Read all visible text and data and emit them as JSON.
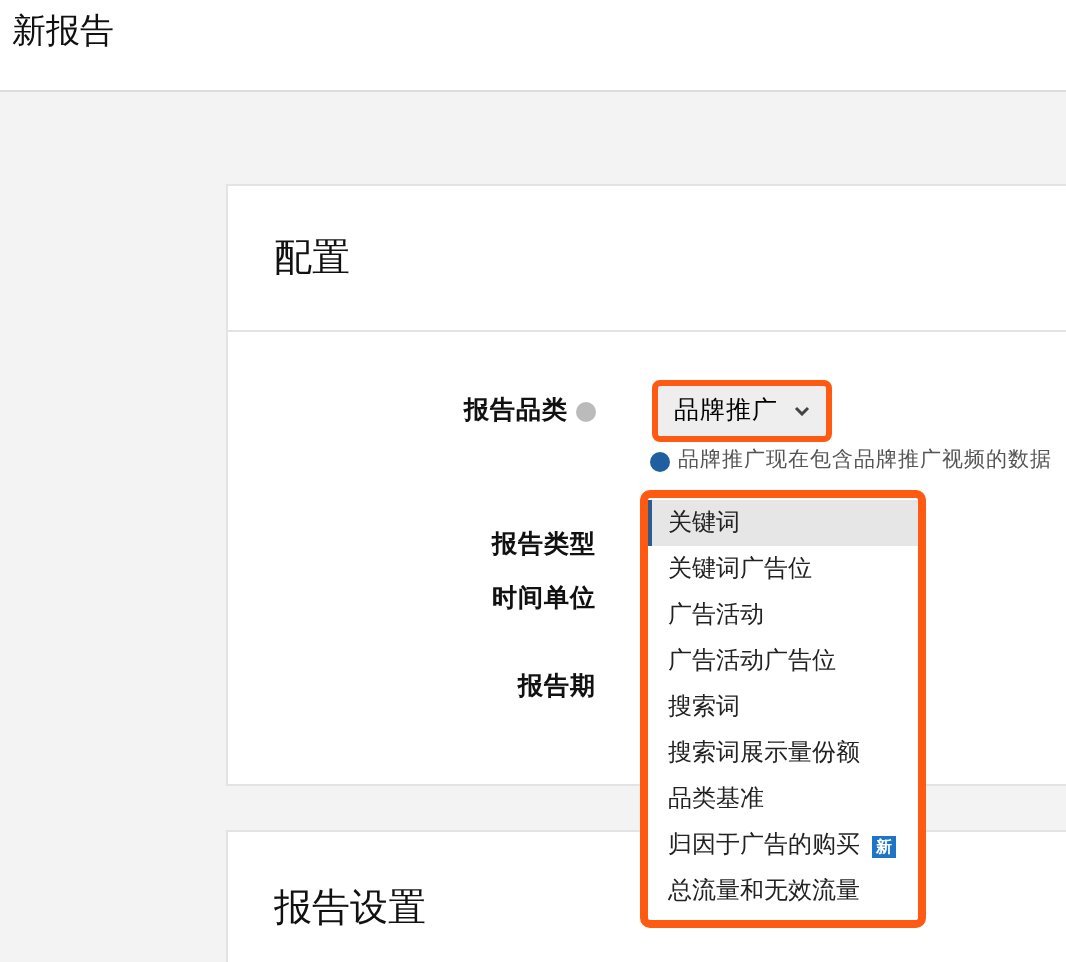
{
  "page_title": "新报告",
  "config_card": {
    "title": "配置",
    "fields": [
      {
        "label": "报告品类",
        "info": true
      },
      {
        "label": "报告类型",
        "info": false
      },
      {
        "label": "时间单位",
        "info": false
      },
      {
        "label": "报告期",
        "info": false
      }
    ],
    "category_select": {
      "value": "品牌推广"
    },
    "category_note": "品牌推广现在包含品牌推广视频的数据",
    "report_type_menu": [
      {
        "label": "关键词",
        "selected": true
      },
      {
        "label": "关键词广告位",
        "selected": false
      },
      {
        "label": "广告活动",
        "selected": false
      },
      {
        "label": "广告活动广告位",
        "selected": false
      },
      {
        "label": "搜索词",
        "selected": false
      },
      {
        "label": "搜索词展示量份额",
        "selected": false
      },
      {
        "label": "品类基准",
        "selected": false
      },
      {
        "label": "归因于广告的购买",
        "selected": false,
        "badge": "新"
      },
      {
        "label": "总流量和无效流量",
        "selected": false
      }
    ]
  },
  "settings_card": {
    "title": "报告设置"
  }
}
